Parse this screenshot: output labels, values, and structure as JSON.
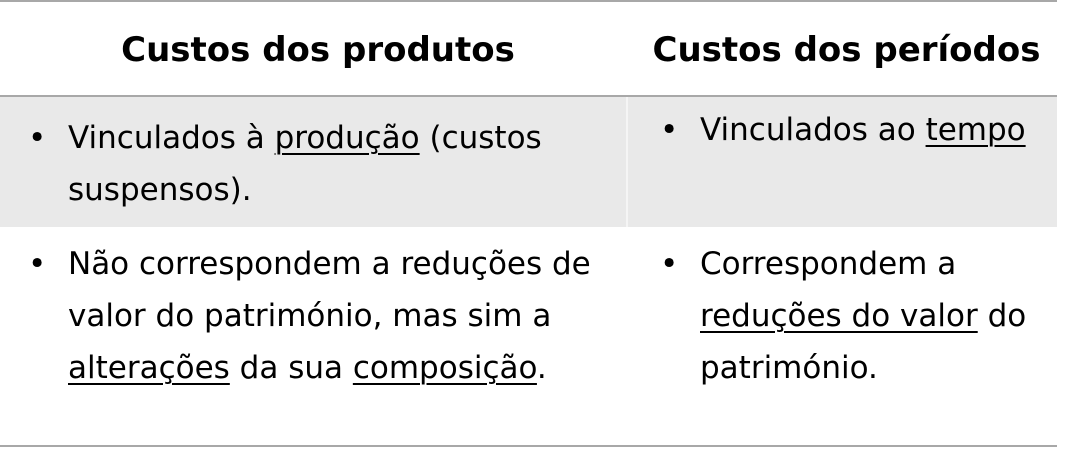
{
  "headers": {
    "product_costs": "Custos dos produtos",
    "period_costs": "Custos dos períodos"
  },
  "rows": [
    {
      "left": {
        "pre": "Vinculados à ",
        "link": "produção",
        "post": " (custos suspensos)."
      },
      "right": {
        "pre": "Vinculados ao ",
        "link": "tempo",
        "post": ""
      }
    },
    {
      "left": {
        "pre": "Não correspondem a reduções de valor do património, mas sim a ",
        "link1": "alterações",
        "mid": " da sua ",
        "link2": "composição",
        "post": "."
      },
      "right": {
        "pre": "Correspondem a ",
        "link": "reduções do valor",
        "post": " do património."
      }
    }
  ],
  "bullet_char": "•"
}
